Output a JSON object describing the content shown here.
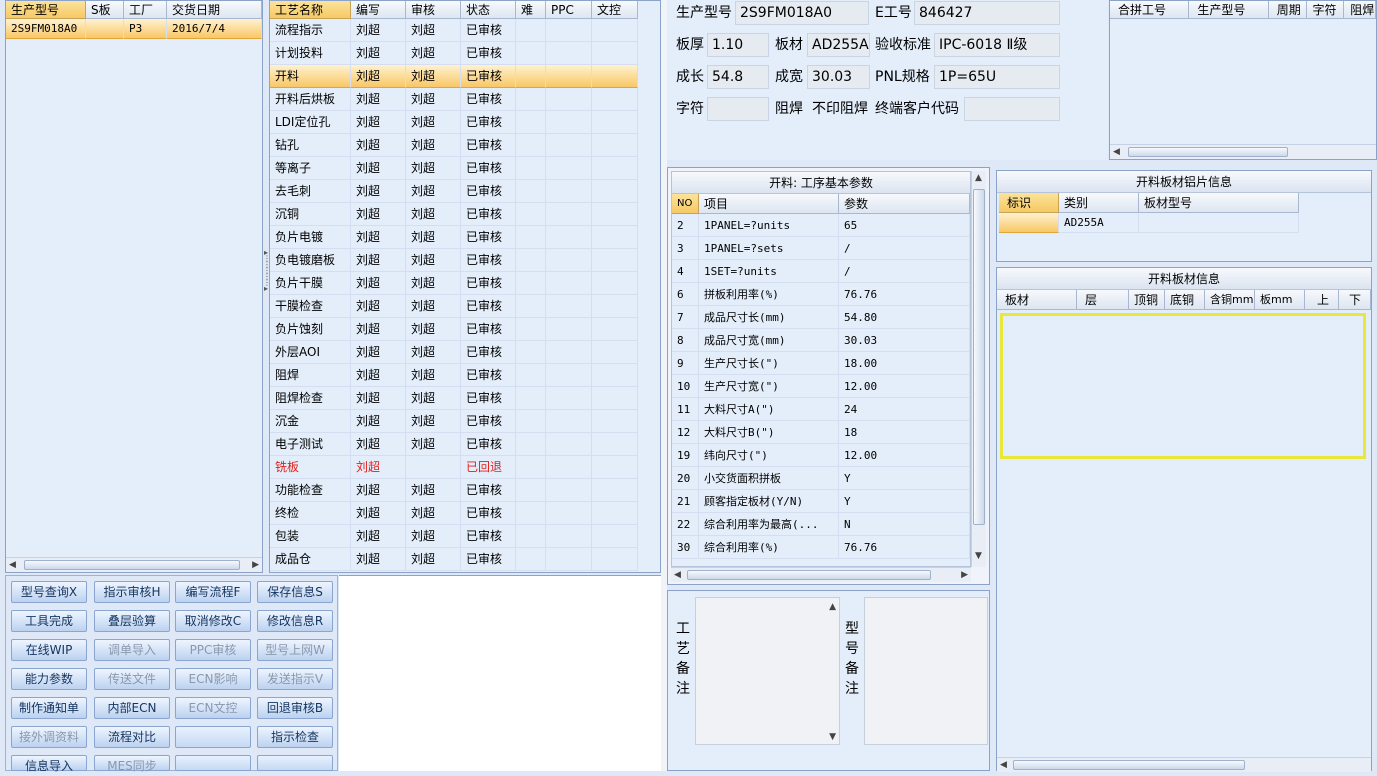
{
  "orders": {
    "headers": [
      "生产型号",
      "S板",
      "工厂",
      "交货日期"
    ],
    "rows": [
      [
        "2S9FM018A0",
        "",
        "P3",
        "2016/7/4"
      ]
    ]
  },
  "process": {
    "headers": [
      "工艺名称",
      "编写",
      "审核",
      "状态",
      "难",
      "PPC",
      "文控"
    ],
    "rows": [
      [
        "流程指示",
        "刘超",
        "刘超",
        "已审核"
      ],
      [
        "计划投料",
        "刘超",
        "刘超",
        "已审核"
      ],
      [
        "开料",
        "刘超",
        "刘超",
        "已审核"
      ],
      [
        "开料后烘板",
        "刘超",
        "刘超",
        "已审核"
      ],
      [
        "LDI定位孔",
        "刘超",
        "刘超",
        "已审核"
      ],
      [
        "钻孔",
        "刘超",
        "刘超",
        "已审核"
      ],
      [
        "等离子",
        "刘超",
        "刘超",
        "已审核"
      ],
      [
        "去毛刺",
        "刘超",
        "刘超",
        "已审核"
      ],
      [
        "沉铜",
        "刘超",
        "刘超",
        "已审核"
      ],
      [
        "负片电镀",
        "刘超",
        "刘超",
        "已审核"
      ],
      [
        "负电镀磨板",
        "刘超",
        "刘超",
        "已审核"
      ],
      [
        "负片干膜",
        "刘超",
        "刘超",
        "已审核"
      ],
      [
        "干膜检查",
        "刘超",
        "刘超",
        "已审核"
      ],
      [
        "负片蚀刻",
        "刘超",
        "刘超",
        "已审核"
      ],
      [
        "外层AOI",
        "刘超",
        "刘超",
        "已审核"
      ],
      [
        "阻焊",
        "刘超",
        "刘超",
        "已审核"
      ],
      [
        "阻焊检查",
        "刘超",
        "刘超",
        "已审核"
      ],
      [
        "沉金",
        "刘超",
        "刘超",
        "已审核"
      ],
      [
        "电子测试",
        "刘超",
        "刘超",
        "已审核"
      ],
      [
        "铣板",
        "刘超",
        "",
        "已回退"
      ],
      [
        "功能检查",
        "刘超",
        "刘超",
        "已审核"
      ],
      [
        "终检",
        "刘超",
        "刘超",
        "已审核"
      ],
      [
        "包装",
        "刘超",
        "刘超",
        "已审核"
      ],
      [
        "成品仓",
        "刘超",
        "刘超",
        "已审核"
      ]
    ],
    "selected_index": 2,
    "red_index": 19
  },
  "buttons": [
    [
      "型号查询X",
      "指示审核H",
      "编写流程F",
      "保存信息S"
    ],
    [
      "工具完成",
      "叠层验算",
      "取消修改C",
      "修改信息R"
    ],
    [
      "在线WIP",
      "调单导入",
      "PPC审核",
      "型号上网W"
    ],
    [
      "能力参数",
      "传送文件",
      "ECN影响",
      "发送指示V"
    ],
    [
      "制作通知单",
      "内部ECN",
      "ECN文控",
      "回退审核B"
    ],
    [
      "接外调资料",
      "流程对比",
      "",
      "指示检查"
    ],
    [
      "信息导入",
      "MES同步",
      "",
      ""
    ]
  ],
  "disabled_buttons": [
    "调单导入",
    "PPC审核",
    "型号上网W",
    "传送文件",
    "ECN影响",
    "发送指示V",
    "ECN文控",
    "接外调资料",
    "MES同步"
  ],
  "info": {
    "model_label": "生产型号",
    "model_value": "2S9FM018A0",
    "eno_label": "E工号",
    "eno_value": "846427",
    "thick_label": "板厚",
    "thick_value": "1.10",
    "material_label": "板材",
    "material_value": "AD255A",
    "std_label": "验收标准",
    "std_value": "IPC-6018 Ⅱ级",
    "len_label": "成长",
    "len_value": "54.8",
    "width_label": "成宽",
    "width_value": "30.03",
    "pnl_label": "PNL规格",
    "pnl_value": "1P=65U",
    "char_label": "字符",
    "char_value": "",
    "mask_label": "阻焊",
    "mask_value": "不印阻焊",
    "cust_label": "终端客户代码",
    "cust_value": ""
  },
  "combine": {
    "headers": [
      "合拼工号",
      "生产型号",
      "周期",
      "字符",
      "阻焊"
    ]
  },
  "params": {
    "title": "开料: 工序基本参数",
    "headers": [
      "NO",
      "项目",
      "参数"
    ],
    "rows": [
      [
        "2",
        "1PANEL=?units",
        "65"
      ],
      [
        "3",
        "1PANEL=?sets",
        "/"
      ],
      [
        "4",
        "1SET=?units",
        "/"
      ],
      [
        "6",
        "拼板利用率(%)",
        "76.76"
      ],
      [
        "7",
        "成品尺寸长(mm)",
        "54.80"
      ],
      [
        "8",
        "成品尺寸宽(mm)",
        "30.03"
      ],
      [
        "9",
        "生产尺寸长(\")",
        "18.00"
      ],
      [
        "10",
        "生产尺寸宽(\")",
        "12.00"
      ],
      [
        "11",
        "大料尺寸A(\")",
        "24"
      ],
      [
        "12",
        "大料尺寸B(\")",
        "18"
      ],
      [
        "19",
        "纬向尺寸(\")",
        "12.00"
      ],
      [
        "20",
        "小交货面积拼板",
        "Y"
      ],
      [
        "21",
        "顾客指定板材(Y/N)",
        "Y"
      ],
      [
        "22",
        "综合利用率为最高(...",
        "N"
      ],
      [
        "30",
        "综合利用率(%)",
        "76.76"
      ]
    ]
  },
  "foil": {
    "title": "开料板材铝片信息",
    "headers": [
      "标识",
      "类别",
      "板材型号"
    ],
    "rows": [
      [
        "",
        "AD255A",
        ""
      ]
    ]
  },
  "sheet": {
    "title": "开料板材信息",
    "headers": [
      "板材",
      "层",
      "顶铜",
      "底铜",
      "含铜mm",
      "板mm",
      "上",
      "下"
    ]
  },
  "notes": {
    "process_label": [
      "工",
      "艺",
      "备",
      "注"
    ],
    "model_label": [
      "型",
      "号",
      "备",
      "注"
    ]
  },
  "colors": {
    "accent": "#f6c964",
    "selection": "#f9c766",
    "highlight_border": "#e8e83c",
    "reject": "#e0201c"
  }
}
